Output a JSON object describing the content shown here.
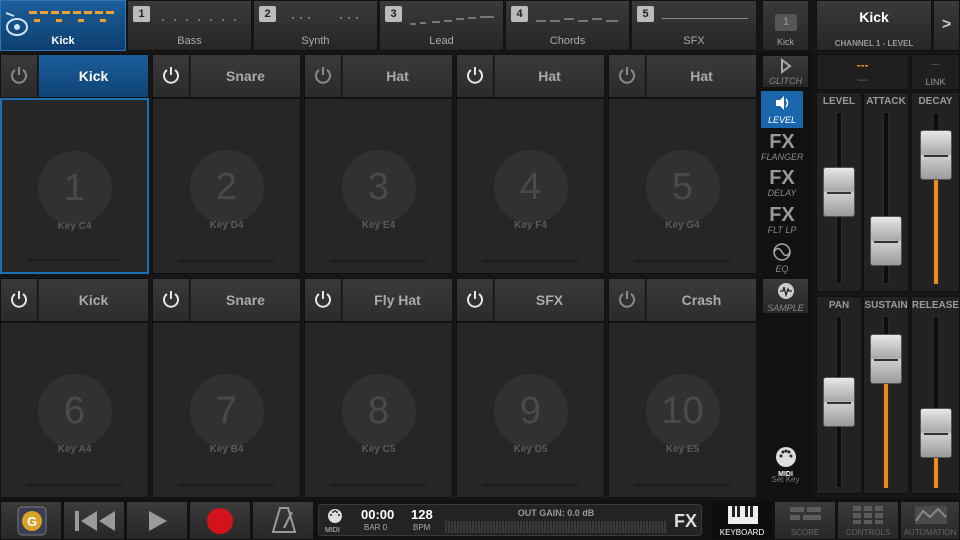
{
  "channels": [
    {
      "num": "",
      "name": "Kick",
      "selected": true
    },
    {
      "num": "1",
      "name": "Bass"
    },
    {
      "num": "2",
      "name": "Synth"
    },
    {
      "num": "3",
      "name": "Lead"
    },
    {
      "num": "4",
      "name": "Chords"
    },
    {
      "num": "5",
      "name": "SFX"
    }
  ],
  "mini_channel": {
    "num": "1",
    "name": "Kick"
  },
  "channel_info": {
    "title": "Kick",
    "subtitle": "CHANNEL 1 - LEVEL",
    "next_glyph": ">"
  },
  "readout": {
    "value": "---",
    "sub": "---",
    "link_top": "---",
    "link_label": "LINK"
  },
  "pads": [
    {
      "label": "Kick",
      "number": "1",
      "key": "Key C4",
      "selected": true
    },
    {
      "label": "Snare",
      "number": "2",
      "key": "Key D4"
    },
    {
      "label": "Hat",
      "number": "3",
      "key": "Key E4"
    },
    {
      "label": "Hat",
      "number": "4",
      "key": "Key F4"
    },
    {
      "label": "Hat",
      "number": "5",
      "key": "Key G4"
    },
    {
      "label": "Kick",
      "number": "6",
      "key": "Key A4"
    },
    {
      "label": "Snare",
      "number": "7",
      "key": "Key B4"
    },
    {
      "label": "Fly Hat",
      "number": "8",
      "key": "Key C5"
    },
    {
      "label": "SFX",
      "number": "9",
      "key": "Key D5"
    },
    {
      "label": "Crash",
      "number": "10",
      "key": "Key E5"
    }
  ],
  "fx": [
    {
      "big": "",
      "label": "GLITCH"
    },
    {
      "big": "",
      "label": "LEVEL",
      "selected": true
    },
    {
      "big": "FX",
      "label": "FLANGER"
    },
    {
      "big": "FX",
      "label": "DELAY"
    },
    {
      "big": "FX",
      "label": "FLT LP"
    },
    {
      "big": "",
      "label": "EQ"
    },
    {
      "big": "",
      "label": "SAMPLE"
    }
  ],
  "midi_side": {
    "label": "MIDI",
    "sub": "Set Key"
  },
  "sliders": [
    {
      "label": "LEVEL",
      "value": 0.55,
      "fill": false
    },
    {
      "label": "ATTACK",
      "value": 0.15,
      "fill": false
    },
    {
      "label": "DECAY",
      "value": 0.85,
      "fill": true
    },
    {
      "label": "PAN",
      "value": 0.5,
      "fill": false
    },
    {
      "label": "SUSTAIN",
      "value": 0.85,
      "fill": true
    },
    {
      "label": "RELEASE",
      "value": 0.25,
      "fill": true
    }
  ],
  "transport": {
    "midi_label": "MIDI",
    "time": "00:00",
    "bar": "BAR 0",
    "bpm": "128",
    "bpm_label": "BPM",
    "out_gain": "OUT GAIN: 0.0 dB",
    "fx": "FX"
  },
  "bottom_tabs": [
    {
      "label": "KEYBOARD",
      "selected": true
    },
    {
      "label": "SCORE"
    },
    {
      "label": "CONTROLS"
    },
    {
      "label": "AUTOMATION"
    }
  ],
  "colors": {
    "accent": "#1a66ad",
    "orange": "#ef8a1f",
    "record": "#d4121c",
    "bg": "#161616"
  }
}
